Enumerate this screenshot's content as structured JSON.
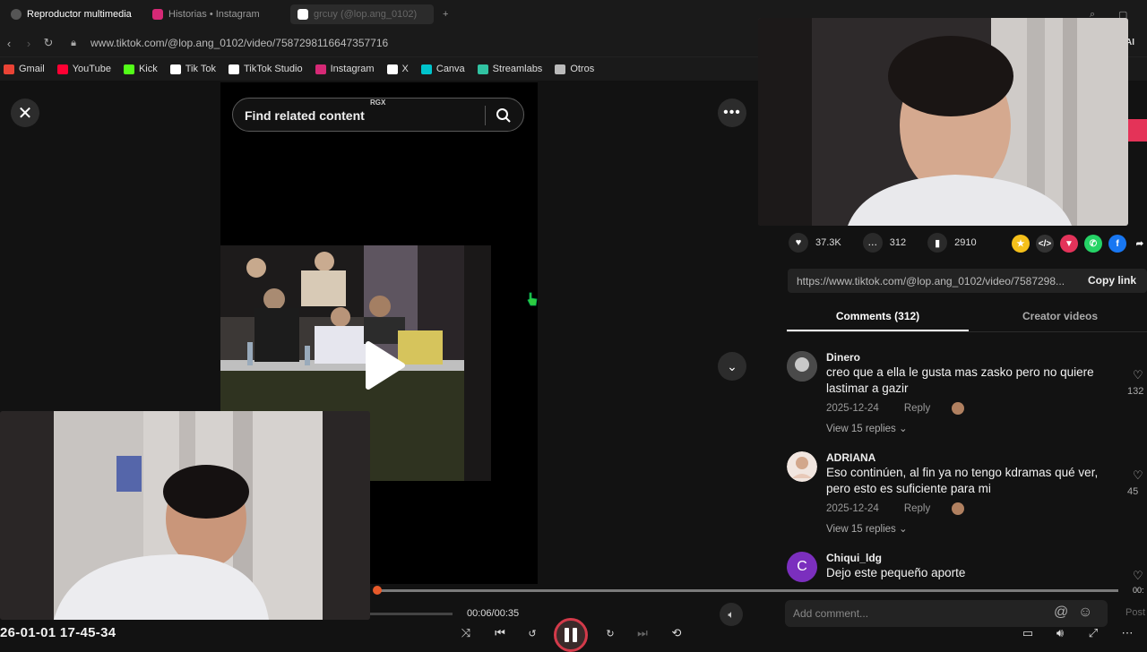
{
  "browser": {
    "tabs": [
      {
        "label": "Reproductor multimedia"
      },
      {
        "label": "Historias • Instagram"
      },
      {
        "label": "grcuy (@lop.ang_0102)"
      }
    ],
    "url": "www.tiktok.com/@lop.ang_0102/video/7587298116647357716",
    "ai_label": "AI"
  },
  "bookmarks": [
    {
      "label": "Gmail",
      "color": "#ea4335"
    },
    {
      "label": "YouTube",
      "color": "#ff0033"
    },
    {
      "label": "Kick",
      "color": "#53fc18"
    },
    {
      "label": "Tik Tok",
      "color": "#ffffff"
    },
    {
      "label": "TikTok Studio",
      "color": "#ffffff"
    },
    {
      "label": "Instagram",
      "color": "#d62976"
    },
    {
      "label": "X",
      "color": "#ffffff"
    },
    {
      "label": "Canva",
      "color": "#00c4cc"
    },
    {
      "label": "Streamlabs",
      "color": "#31c3a2"
    },
    {
      "label": "Otros",
      "color": "#bbbbbb"
    }
  ],
  "search": {
    "placeholder": "Find related content",
    "badge": "RGX"
  },
  "stats": {
    "likes": "37.3K",
    "comments": "312",
    "saves": "2910"
  },
  "share_link": {
    "url": "https://www.tiktok.com/@lop.ang_0102/video/7587298...",
    "copy_label": "Copy link"
  },
  "panel_tabs": {
    "comments": "Comments (312)",
    "creator": "Creator videos"
  },
  "comments": [
    {
      "name": "Dinero",
      "text": "creo que a ella le gusta mas zasko pero no quiere lastimar a gazir",
      "date": "2025-12-24",
      "reply": "Reply",
      "replies": "View 15 replies",
      "likes": "132"
    },
    {
      "name": "ADRIANA",
      "text": "Eso continúen, al fin ya no tengo kdramas qué ver, pero esto es suficiente para mi",
      "date": "2025-12-24",
      "reply": "Reply",
      "replies": "View 15 replies",
      "likes": "45"
    },
    {
      "name": "Chiqui_ldg",
      "text": "Dejo este pequeño aporte",
      "avatar_letter": "C"
    }
  ],
  "comment_input": {
    "placeholder": "Add comment...",
    "post": "Post"
  },
  "player": {
    "time": "00:06/00:35",
    "end_time": "00:",
    "progress": 0.005
  },
  "overlay_timestamp": "26-01-01 17-45-34",
  "colors": {
    "accent": "#e75a2a",
    "tiktok_pink": "#e43358"
  }
}
